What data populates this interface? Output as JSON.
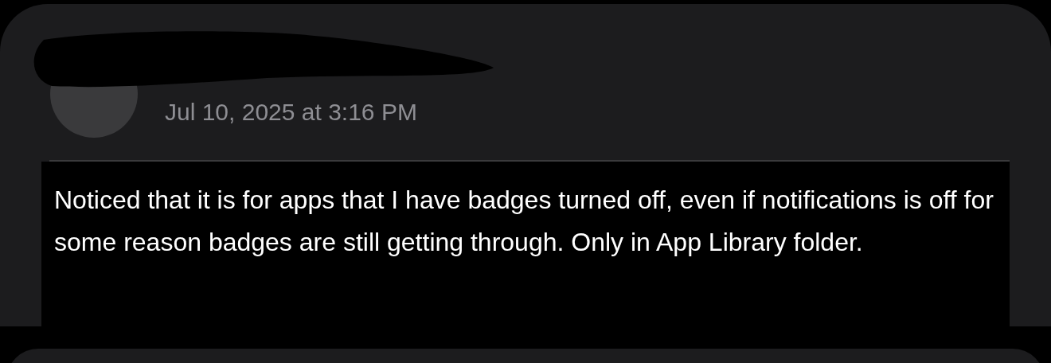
{
  "post": {
    "timestamp": "Jul 10, 2025 at 3:16 PM",
    "body": "Noticed that it is for apps that I have badges turned off, even if notifications is off for some reason badges are still getting through. Only in App Library folder."
  }
}
